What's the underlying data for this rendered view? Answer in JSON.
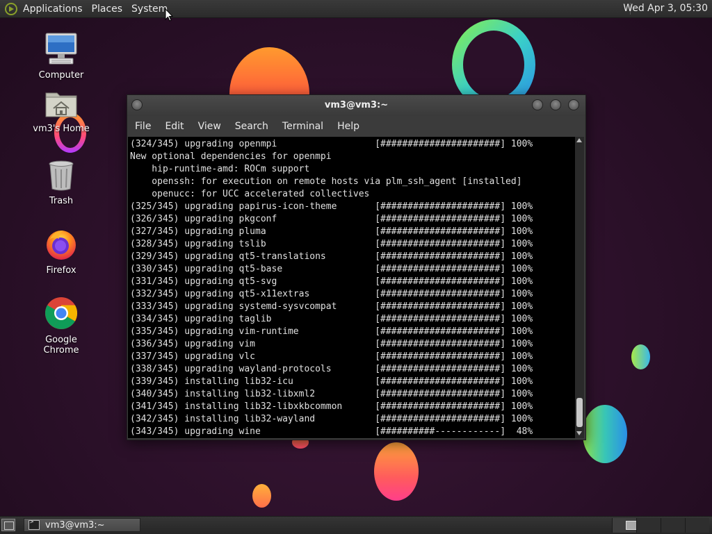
{
  "top_panel": {
    "menus": [
      "Applications",
      "Places",
      "System"
    ],
    "clock": "Wed Apr 3, 05:30"
  },
  "desktop_icons": {
    "computer": "Computer",
    "home": "vm3's Home",
    "trash": "Trash",
    "firefox": "Firefox",
    "chrome": "Google Chrome"
  },
  "terminal": {
    "title": "vm3@vm3:~",
    "menu": [
      "File",
      "Edit",
      "View",
      "Search",
      "Terminal",
      "Help"
    ],
    "lines": [
      "(324/345) upgrading openmpi                  [######################] 100%",
      "New optional dependencies for openmpi",
      "    hip-runtime-amd: ROCm support",
      "    openssh: for execution on remote hosts via plm_ssh_agent [installed]",
      "    openucc: for UCC accelerated collectives",
      "(325/345) upgrading papirus-icon-theme       [######################] 100%",
      "(326/345) upgrading pkgconf                  [######################] 100%",
      "(327/345) upgrading pluma                    [######################] 100%",
      "(328/345) upgrading tslib                    [######################] 100%",
      "(329/345) upgrading qt5-translations         [######################] 100%",
      "(330/345) upgrading qt5-base                 [######################] 100%",
      "(331/345) upgrading qt5-svg                  [######################] 100%",
      "(332/345) upgrading qt5-x11extras            [######################] 100%",
      "(333/345) upgrading systemd-sysvcompat       [######################] 100%",
      "(334/345) upgrading taglib                   [######################] 100%",
      "(335/345) upgrading vim-runtime              [######################] 100%",
      "(336/345) upgrading vim                      [######################] 100%",
      "(337/345) upgrading vlc                      [######################] 100%",
      "(338/345) upgrading wayland-protocols        [######################] 100%",
      "(339/345) installing lib32-icu               [######################] 100%",
      "(340/345) installing lib32-libxml2           [######################] 100%",
      "(341/345) installing lib32-libxkbcommon      [######################] 100%",
      "(342/345) installing lib32-wayland           [######################] 100%",
      "(343/345) upgrading wine                     [##########------------]  48%"
    ]
  },
  "bottom_panel": {
    "task_label": "vm3@vm3:~"
  },
  "icons": {
    "panel_logo": "mate-logo-icon",
    "computer": "computer-icon",
    "home": "home-folder-icon",
    "trash": "trash-icon",
    "firefox": "firefox-icon",
    "chrome": "chrome-icon",
    "terminal_task": "terminal-icon"
  },
  "colors": {
    "desktop_bg": "#2b1029",
    "terminal_bg": "#000000",
    "terminal_fg": "#e0e0e0",
    "panel_bg": "#2b2b2b"
  }
}
